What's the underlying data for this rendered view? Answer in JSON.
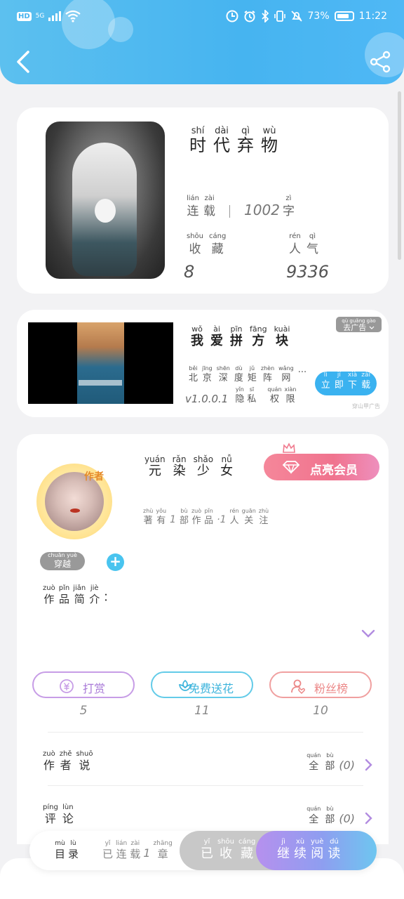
{
  "status_bar": {
    "hd": "HD",
    "network": "5G",
    "battery_percent": "73%",
    "time": "11:22"
  },
  "header": {
    "back_icon": "back-arrow-icon",
    "share_icon": "share-icon"
  },
  "book": {
    "title_chars": [
      {
        "p": "shí",
        "c": "时"
      },
      {
        "p": "dài",
        "c": "代"
      },
      {
        "p": "qì",
        "c": "弃"
      },
      {
        "p": "wù",
        "c": "物"
      }
    ],
    "status_chars": [
      {
        "p": "lián",
        "c": "连"
      },
      {
        "p": "zài",
        "c": "载"
      }
    ],
    "word_count": "1002",
    "word_unit": {
      "p": "zì",
      "c": "字"
    },
    "collect_label": [
      {
        "p": "shōu",
        "c": "收"
      },
      {
        "p": "cáng",
        "c": "藏"
      }
    ],
    "popularity_label": [
      {
        "p": "rén",
        "c": "人"
      },
      {
        "p": "qì",
        "c": "气"
      }
    ],
    "collect_count": "8",
    "popularity_count": "9336"
  },
  "ad": {
    "title_chars": [
      {
        "p": "wǒ",
        "c": "我"
      },
      {
        "p": "ài",
        "c": "爱"
      },
      {
        "p": "pīn",
        "c": "拼"
      },
      {
        "p": "fāng",
        "c": "方"
      },
      {
        "p": "kuài",
        "c": "块"
      }
    ],
    "publisher_chars": [
      {
        "p": "běi",
        "c": "北"
      },
      {
        "p": "jīng",
        "c": "京"
      },
      {
        "p": "shēn",
        "c": "深"
      },
      {
        "p": "dù",
        "c": "度"
      },
      {
        "p": "jǔ",
        "c": "矩"
      },
      {
        "p": "zhèn",
        "c": "阵"
      },
      {
        "p": "wǎng",
        "c": "网"
      },
      {
        "p": "",
        "c": "..."
      }
    ],
    "version": "v1.0.0.1",
    "privacy_chars": [
      {
        "p": "yǐn",
        "c": "隐"
      },
      {
        "p": "sī",
        "c": "私"
      }
    ],
    "permission_chars": [
      {
        "p": "quán",
        "c": "权"
      },
      {
        "p": "xiàn",
        "c": "限"
      }
    ],
    "remove_ad_pinyin": "qù guǎng gào",
    "remove_ad": "去广告",
    "download_chars": [
      {
        "p": "lì",
        "c": "立"
      },
      {
        "p": "jí",
        "c": "即"
      },
      {
        "p": "xià",
        "c": "下"
      },
      {
        "p": "zài",
        "c": "载"
      }
    ],
    "footer": "穿山甲广告"
  },
  "author": {
    "badge": "作者",
    "name_chars": [
      {
        "p": "yuán",
        "c": "元"
      },
      {
        "p": "rǎn",
        "c": "染"
      },
      {
        "p": "shǎo",
        "c": "少"
      },
      {
        "p": "nǚ",
        "c": "女"
      }
    ],
    "works_pre": [
      {
        "p": "zhù",
        "c": "著"
      },
      {
        "p": "yǒu",
        "c": "有"
      }
    ],
    "works_count": "1",
    "works_post": [
      {
        "p": "bù",
        "c": "部"
      },
      {
        "p": "zuò",
        "c": "作"
      },
      {
        "p": "pǐn",
        "c": "品"
      }
    ],
    "fans_count": "·1",
    "fans_post": [
      {
        "p": "rén",
        "c": "人"
      },
      {
        "p": "guān",
        "c": "关"
      },
      {
        "p": "zhù",
        "c": "注"
      }
    ],
    "vip_label": "点亮会员",
    "tag": {
      "p": "chuān yuè",
      "c": "穿越"
    },
    "intro_chars": [
      {
        "p": "zuò",
        "c": "作"
      },
      {
        "p": "pǐn",
        "c": "品"
      },
      {
        "p": "jiǎn",
        "c": "简"
      },
      {
        "p": "jiè",
        "c": "介"
      }
    ],
    "intro_colon": "："
  },
  "actions": [
    {
      "label": "打赏",
      "count": "5",
      "icon": "coin-icon"
    },
    {
      "label": "免费送花",
      "count": "11",
      "icon": "flower-icon"
    },
    {
      "label": "粉丝榜",
      "count": "10",
      "icon": "fan-user-icon"
    }
  ],
  "rows": {
    "author_says": [
      {
        "p": "zuò",
        "c": "作"
      },
      {
        "p": "zhě",
        "c": "者"
      },
      {
        "p": "shuō",
        "c": "说"
      }
    ],
    "comments": [
      {
        "p": "píng",
        "c": "评"
      },
      {
        "p": "lùn",
        "c": "论"
      }
    ],
    "all_chars": [
      {
        "p": "quán",
        "c": "全"
      },
      {
        "p": "bù",
        "c": "部"
      }
    ],
    "author_says_count": "(0)",
    "comments_count": "(0)"
  },
  "bottom_bar": {
    "toc_chars": [
      {
        "p": "mù",
        "c": "目"
      },
      {
        "p": "lù",
        "c": "录"
      }
    ],
    "serial_chars": [
      {
        "p": "yǐ",
        "c": "已"
      },
      {
        "p": "lián",
        "c": "连"
      },
      {
        "p": "zài",
        "c": "载"
      }
    ],
    "serial_count": "1",
    "chapter_char": {
      "p": "zhāng",
      "c": "章"
    },
    "collected_chars": [
      {
        "p": "yǐ",
        "c": "已"
      },
      {
        "p": "shōu",
        "c": "收"
      },
      {
        "p": "cáng",
        "c": "藏"
      }
    ],
    "continue_chars": [
      {
        "p": "jì",
        "c": "继"
      },
      {
        "p": "xù",
        "c": "续"
      },
      {
        "p": "yuè",
        "c": "阅"
      },
      {
        "p": "dú",
        "c": "读"
      }
    ]
  }
}
